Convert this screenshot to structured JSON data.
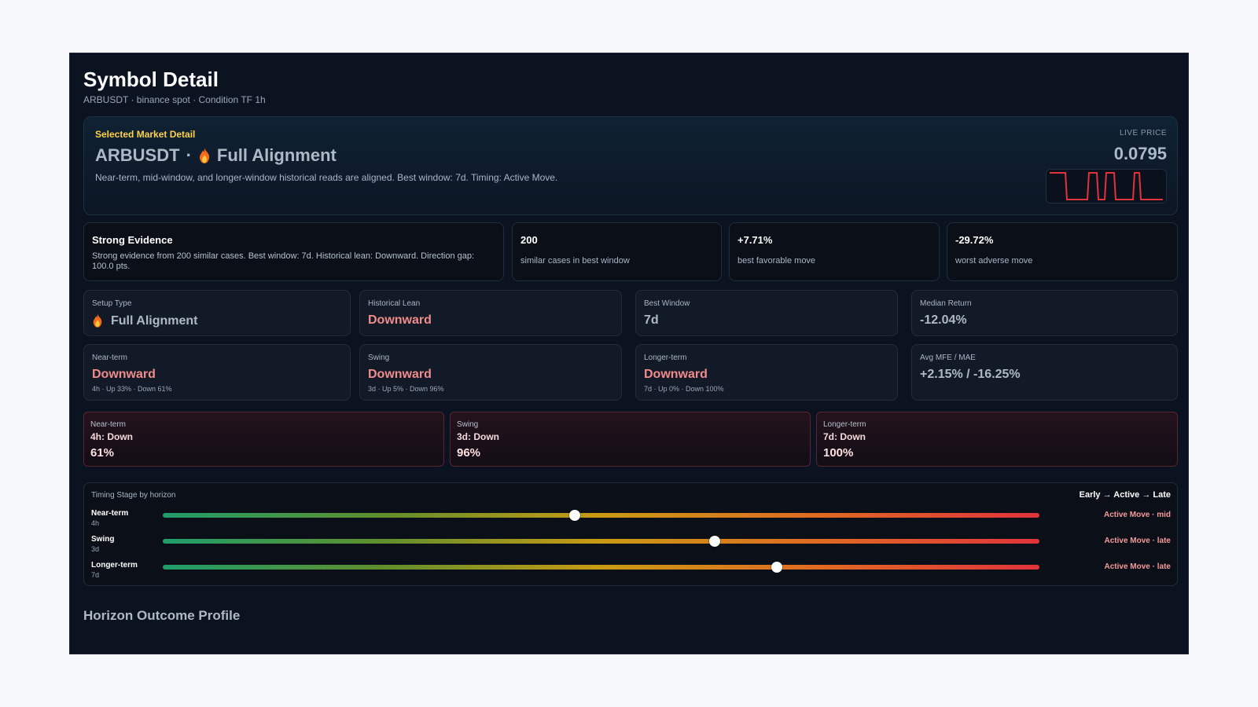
{
  "page": {
    "title": "Symbol Detail",
    "subtitle": "ARBUSDT · binance spot · Condition TF 1h"
  },
  "hero": {
    "kicker": "Selected Market Detail",
    "symbol": "ARBUSDT",
    "separator": "·",
    "setup_icon": "flame-icon",
    "setup": "Full Alignment",
    "description": "Near-term, mid-window, and longer-window historical reads are aligned. Best window: 7d. Timing: Active Move.",
    "live_price_label": "LIVE PRICE",
    "live_price": "0.0795",
    "sparkline_color": "#e0333c"
  },
  "evidence": {
    "title": "Strong Evidence",
    "description": "Strong evidence from 200 similar cases. Best window: 7d. Historical lean: Downward. Direction gap: 100.0 pts."
  },
  "stats": [
    {
      "value": "200",
      "label": "similar cases in best window"
    },
    {
      "value": "+7.71%",
      "label": "best favorable move"
    },
    {
      "value": "-29.72%",
      "label": "worst adverse move"
    }
  ],
  "metrics": [
    {
      "label": "Setup Type",
      "value": "Full Alignment",
      "icon": "flame-icon"
    },
    {
      "label": "Historical Lean",
      "value": "Downward"
    },
    {
      "label": "Best Window",
      "value": "7d"
    },
    {
      "label": "Median Return",
      "value": "-12.04%"
    }
  ],
  "horizon_metrics": [
    {
      "label": "Near-term",
      "value": "Downward",
      "sub": "4h · Up 33% · Down 61%"
    },
    {
      "label": "Swing",
      "value": "Downward",
      "sub": "3d · Up 5% · Down 96%"
    },
    {
      "label": "Longer-term",
      "value": "Downward",
      "sub": "7d · Up 0% · Down 100%"
    },
    {
      "label": "Avg MFE / MAE",
      "value": "+2.15% / -16.25%"
    }
  ],
  "horizon_cards": [
    {
      "label": "Near-term",
      "title": "4h: Down",
      "pct": "61%"
    },
    {
      "label": "Swing",
      "title": "3d: Down",
      "pct": "96%"
    },
    {
      "label": "Longer-term",
      "title": "7d: Down",
      "pct": "100%"
    }
  ],
  "timing": {
    "heading": "Timing Stage by horizon",
    "legend": "Early → Active → Late",
    "rows": [
      {
        "name": "Near-term",
        "sub": "4h",
        "stage": "Active Move · mid",
        "position": 0.47
      },
      {
        "name": "Swing",
        "sub": "3d",
        "stage": "Active Move · late",
        "position": 0.63
      },
      {
        "name": "Longer-term",
        "sub": "7d",
        "stage": "Active Move · late",
        "position": 0.7
      }
    ]
  },
  "section": {
    "title": "Horizon Outcome Profile"
  }
}
